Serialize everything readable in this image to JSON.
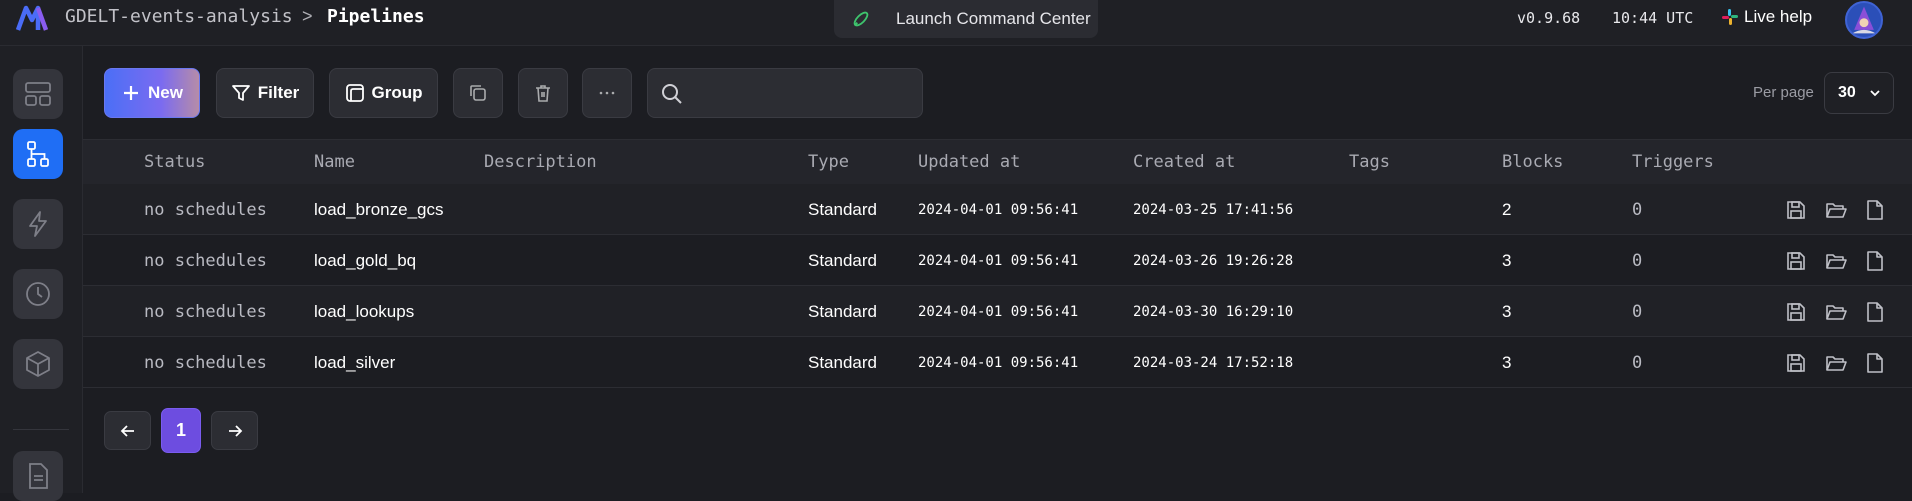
{
  "header": {
    "project_name": "GDELT-events-analysis",
    "separator": ">",
    "page_title": "Pipelines",
    "command_center_label": "Launch Command Center",
    "version": "v0.9.68",
    "time": "10:44 UTC",
    "live_help_label": "Live help"
  },
  "toolbar": {
    "new_label": "New",
    "filter_label": "Filter",
    "group_label": "Group",
    "search_placeholder": "",
    "per_page_label": "Per page",
    "per_page_value": "30"
  },
  "table": {
    "columns": [
      "Status",
      "Name",
      "Description",
      "Type",
      "Updated at",
      "Created at",
      "Tags",
      "Blocks",
      "Triggers"
    ],
    "rows": [
      {
        "status": "no schedules",
        "name": "load_bronze_gcs",
        "description": "",
        "type": "Standard",
        "updated_at": "2024-04-01 09:56:41",
        "created_at": "2024-03-25 17:41:56",
        "tags": "",
        "blocks": "2",
        "triggers": "0"
      },
      {
        "status": "no schedules",
        "name": "load_gold_bq",
        "description": "",
        "type": "Standard",
        "updated_at": "2024-04-01 09:56:41",
        "created_at": "2024-03-26 19:26:28",
        "tags": "",
        "blocks": "3",
        "triggers": "0"
      },
      {
        "status": "no schedules",
        "name": "load_lookups",
        "description": "",
        "type": "Standard",
        "updated_at": "2024-04-01 09:56:41",
        "created_at": "2024-03-30 16:29:10",
        "tags": "",
        "blocks": "3",
        "triggers": "0"
      },
      {
        "status": "no schedules",
        "name": "load_silver",
        "description": "",
        "type": "Standard",
        "updated_at": "2024-04-01 09:56:41",
        "created_at": "2024-03-24 17:52:18",
        "tags": "",
        "blocks": "3",
        "triggers": "0"
      }
    ]
  },
  "pagination": {
    "current_page": "1"
  },
  "icons": {
    "sidebar": [
      "dashboard-icon",
      "pipelines-icon",
      "triggers-icon",
      "runs-icon",
      "blocks-icon",
      "files-icon"
    ],
    "row_actions": [
      "save-icon",
      "folder-open-icon",
      "file-icon"
    ]
  },
  "colors": {
    "accent": "#1f6ef5",
    "page_active": "#6d4de0",
    "new_gradient_start": "#4b6ff6",
    "new_gradient_end": "#b68ca8"
  }
}
